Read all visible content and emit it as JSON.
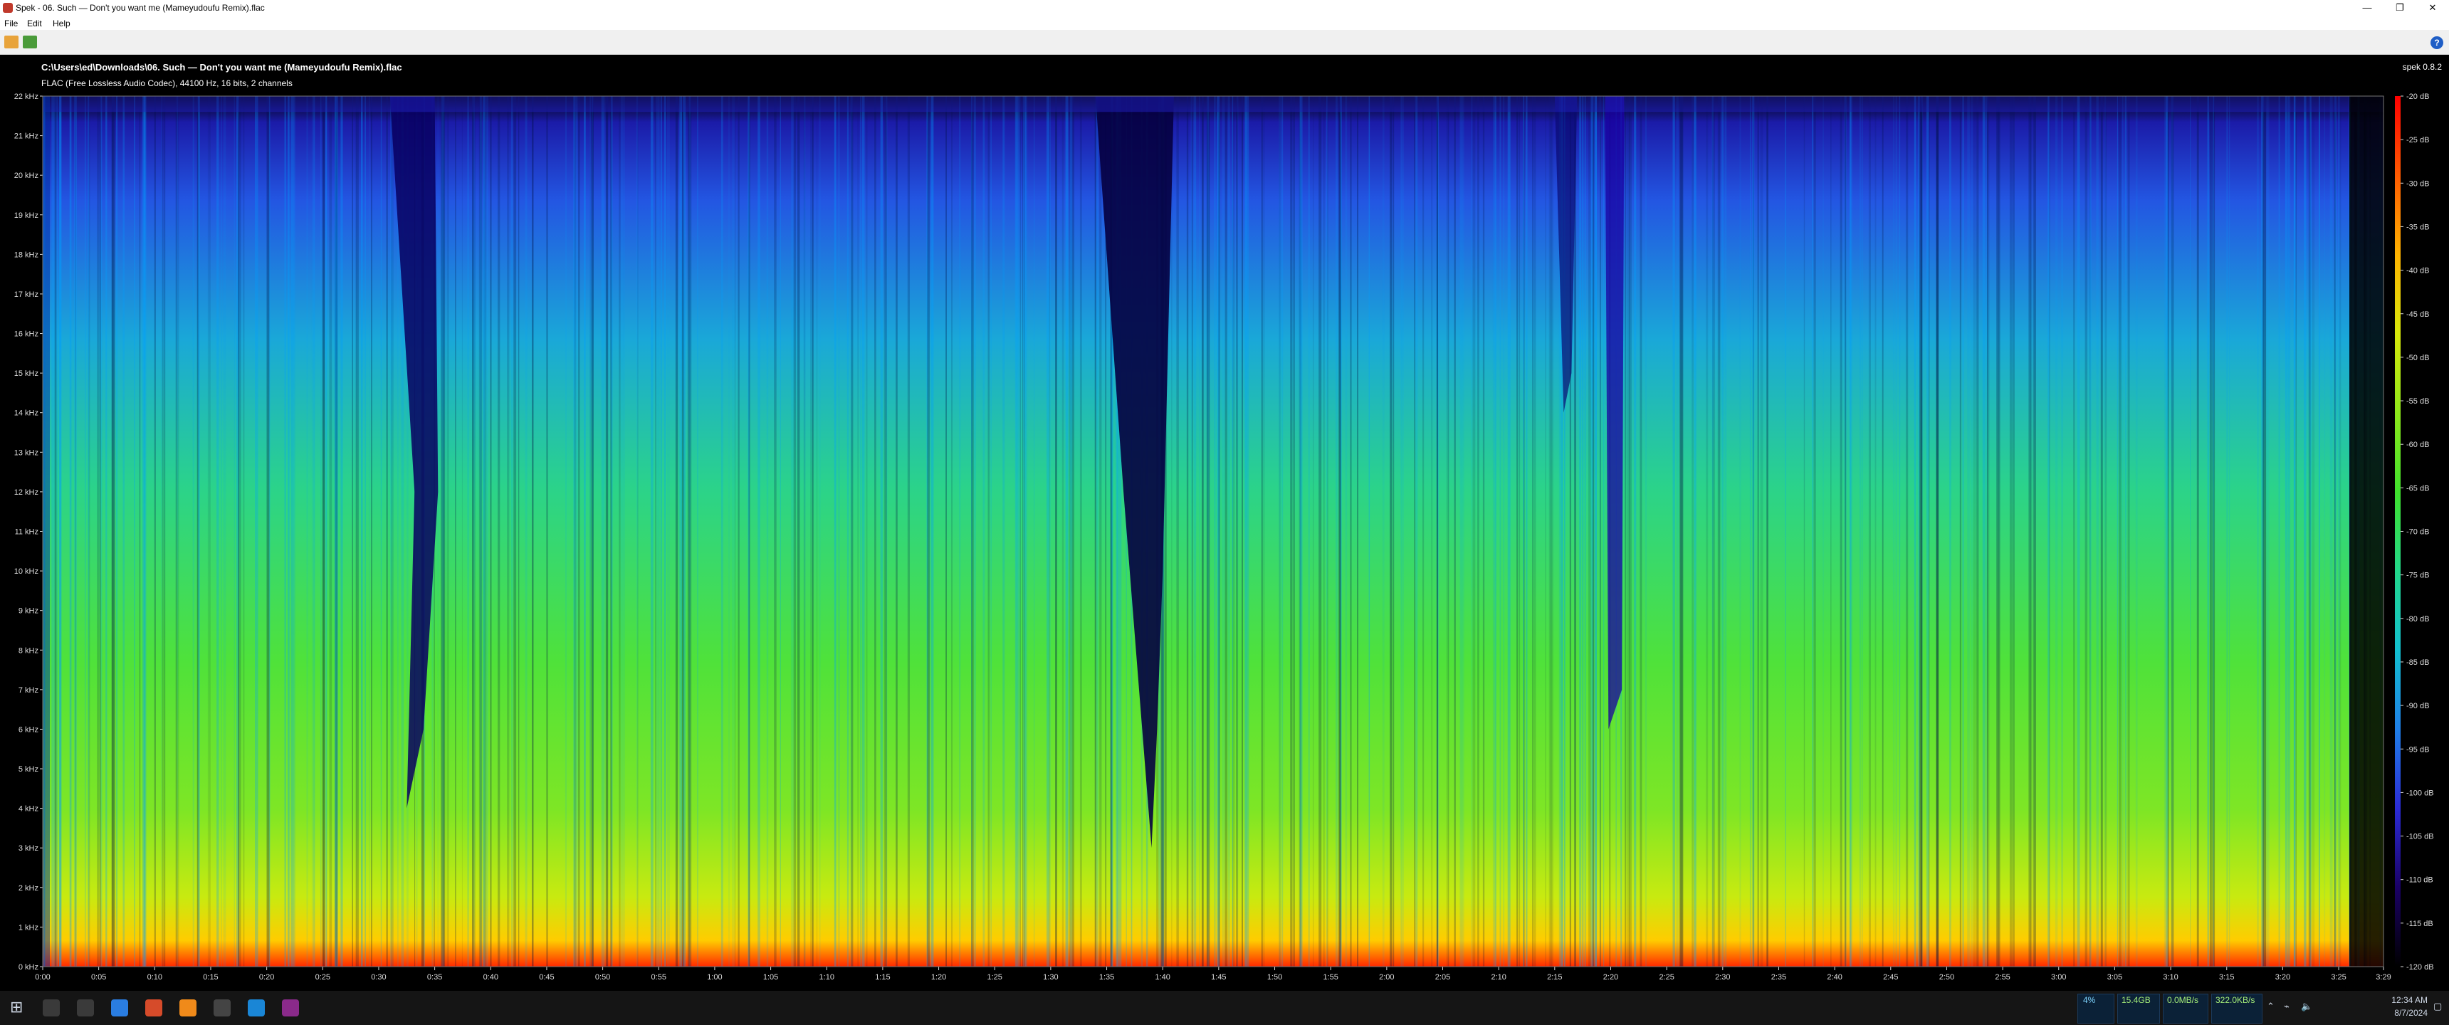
{
  "window": {
    "title": "Spek - 06. Such — Don't you want me (Mameyudoufu Remix).flac",
    "buttons": {
      "minimize": "—",
      "maximize": "❐",
      "close": "✕"
    }
  },
  "menu": [
    "File",
    "Edit",
    "Help"
  ],
  "toolbar": {
    "open_icon": "folder-open-icon",
    "save_icon": "save-icon",
    "help_label": "?"
  },
  "header": {
    "file_path": "C:\\Users\\ed\\Downloads\\06. Such — Don't you want me (Mameyudoufu Remix).flac",
    "info": "FLAC (Free Lossless Audio Codec), 44100 Hz, 16 bits, 2 channels",
    "brand": "spek 0.8.2"
  },
  "chart_data": {
    "type": "heatmap",
    "title": "",
    "xlabel": "",
    "ylabel": "",
    "xlim": [
      0,
      209
    ],
    "ylim": [
      0,
      22
    ],
    "db_range": [
      -120,
      -20
    ],
    "y_ticks": [
      "0 kHz",
      "1 kHz",
      "2 kHz",
      "3 kHz",
      "4 kHz",
      "5 kHz",
      "6 kHz",
      "7 kHz",
      "8 kHz",
      "9 kHz",
      "10 kHz",
      "11 kHz",
      "12 kHz",
      "13 kHz",
      "14 kHz",
      "15 kHz",
      "16 kHz",
      "17 kHz",
      "18 kHz",
      "19 kHz",
      "20 kHz",
      "21 kHz",
      "22 kHz"
    ],
    "x_ticks": [
      "0:00",
      "0:05",
      "0:10",
      "0:15",
      "0:20",
      "0:25",
      "0:30",
      "0:35",
      "0:40",
      "0:45",
      "0:50",
      "0:55",
      "1:00",
      "1:05",
      "1:10",
      "1:15",
      "1:20",
      "1:25",
      "1:30",
      "1:35",
      "1:40",
      "1:45",
      "1:50",
      "1:55",
      "2:00",
      "2:05",
      "2:10",
      "2:15",
      "2:20",
      "2:25",
      "2:30",
      "2:35",
      "2:40",
      "2:45",
      "2:50",
      "2:55",
      "3:00",
      "3:05",
      "3:10",
      "3:15",
      "3:20",
      "3:25",
      "3:29"
    ],
    "db_ticks": [
      "-20 dB",
      "-25 dB",
      "-30 dB",
      "-35 dB",
      "-40 dB",
      "-45 dB",
      "-50 dB",
      "-55 dB",
      "-60 dB",
      "-65 dB",
      "-70 dB",
      "-75 dB",
      "-80 dB",
      "-85 dB",
      "-90 dB",
      "-95 dB",
      "-100 dB",
      "-105 dB",
      "-110 dB",
      "-115 dB",
      "-120 dB"
    ],
    "colormap": [
      "#000000",
      "#1a0066",
      "#2b2bd6",
      "#1f7fe8",
      "#12c0d0",
      "#22d88a",
      "#3fe12c",
      "#8ee81a",
      "#d8e80a",
      "#ffb300",
      "#ff5a00",
      "#ff0000"
    ]
  },
  "taskbar": {
    "start": "⊞",
    "icons": [
      "search-icon",
      "taskview-icon",
      "file-explorer-icon",
      "browser-icon",
      "firefox-icon",
      "terminal-icon",
      "vscode-icon",
      "spek-icon"
    ],
    "tray": {
      "cpu": "4%",
      "ram": "15.4GB",
      "net_up": "0.0MB/s",
      "net_down": "322.0KB/s",
      "time": "12:34 AM",
      "date": "8/7/2024"
    }
  }
}
